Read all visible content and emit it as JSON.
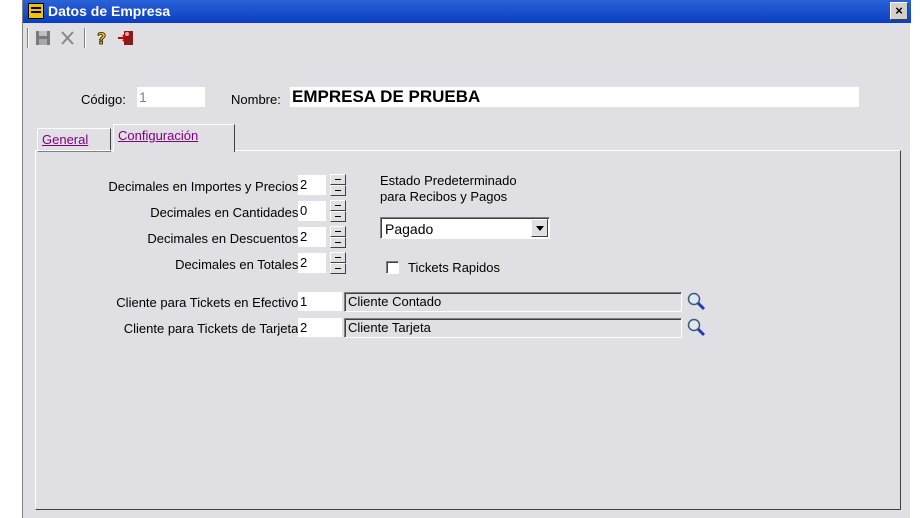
{
  "window": {
    "title": "Datos de Empresa",
    "close_label": "×"
  },
  "toolbar": {
    "items": [
      "save-icon",
      "cancel-icon",
      "help-icon",
      "exit-icon"
    ]
  },
  "header": {
    "codigo_label": "Código:",
    "codigo_value": "1",
    "nombre_label": "Nombre:",
    "nombre_value": "EMPRESA DE PRUEBA"
  },
  "tabs": [
    {
      "label": "General",
      "active": false
    },
    {
      "label": "Configuración",
      "active": true
    }
  ],
  "config": {
    "decimales": [
      {
        "label": "Decimales en Importes y Precios:",
        "value": "2"
      },
      {
        "label": "Decimales en Cantidades:",
        "value": "0"
      },
      {
        "label": "Decimales en Descuentos:",
        "value": "2"
      },
      {
        "label": "Decimales en Totales:",
        "value": "2"
      }
    ],
    "estado_label_1": "Estado Predeterminado",
    "estado_label_2": "para Recibos y Pagos",
    "estado_value": "Pagado",
    "tickets_rapidos_label": "Tickets Rapidos",
    "tickets_rapidos_checked": false,
    "clientes": [
      {
        "label": "Cliente para Tickets en Efectivo:",
        "code": "1",
        "name": "Cliente Contado"
      },
      {
        "label": "Cliente para Tickets de Tarjeta:",
        "code": "2",
        "name": "Cliente Tarjeta"
      }
    ]
  },
  "colors": {
    "titlebar": "#0a3ec0",
    "face": "#e0dfe3",
    "tab_text": "#800080"
  }
}
